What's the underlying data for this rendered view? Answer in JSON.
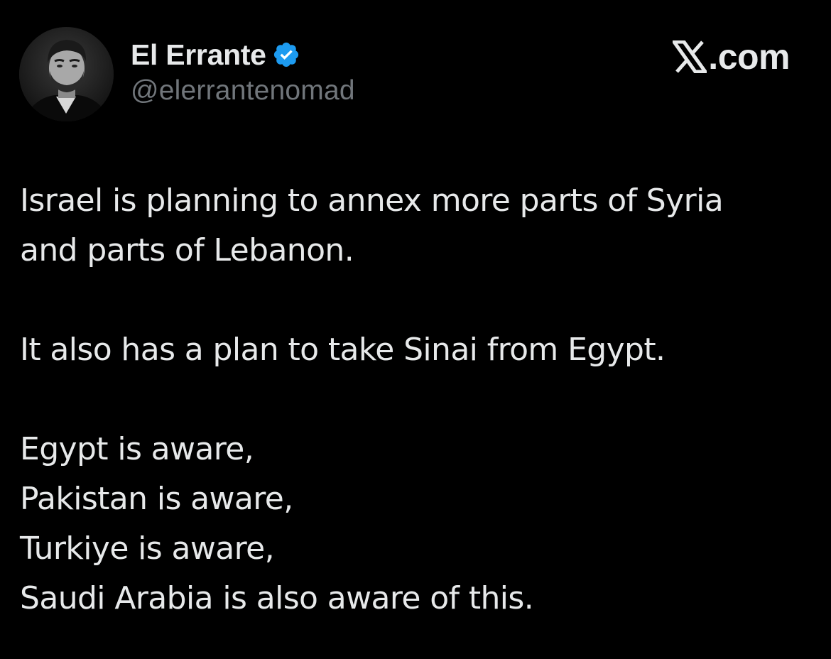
{
  "author": {
    "display_name": "El Errante",
    "handle": "@elerrantenomad",
    "verified": true,
    "verified_color": "#1d9bf0",
    "avatar_icon": "profile-photo"
  },
  "brand": {
    "logo_icon": "x-logo",
    "text": ".com"
  },
  "tweet": {
    "paragraphs": [
      {
        "lines": [
          "Israel is planning to annex more parts of Syria",
          "and parts of Lebanon."
        ]
      },
      {
        "lines": [
          "It also has a plan to take Sinai from Egypt."
        ]
      },
      {
        "lines": [
          "Egypt is aware,",
          "Pakistan is aware,",
          "Turkiye is aware,",
          "Saudi Arabia is also aware of this."
        ]
      }
    ]
  },
  "colors": {
    "background": "#000000",
    "primary_text": "#e7e9ea",
    "secondary_text": "#71767b"
  }
}
